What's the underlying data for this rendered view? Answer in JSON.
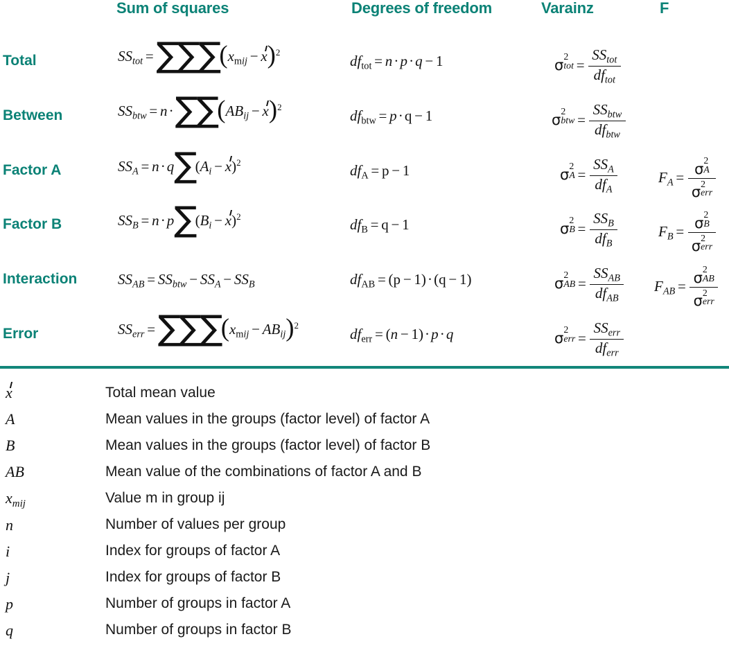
{
  "table": {
    "headers": [
      {
        "id": "sum-of-squares",
        "label": "Sum of squares"
      },
      {
        "id": "degrees-of-freedom",
        "label": "Degrees of freedom"
      },
      {
        "id": "varainz",
        "label": "Varainz"
      },
      {
        "id": "f",
        "label": "F"
      }
    ],
    "rows": [
      {
        "id": "total",
        "label": "Total",
        "ss": "SS_tot = ΣΣΣ(x_mij − x̄)²",
        "df": "df_tot = n · p · q − 1",
        "var": "σ²_tot = SS_tot / df_tot",
        "f": ""
      },
      {
        "id": "between",
        "label": "Between",
        "ss": "SS_btw = n · ΣΣ(AB_ij − x̄)²",
        "df": "df_btw = p · q − 1",
        "var": "σ²_btw = SS_btw / df_btw",
        "f": ""
      },
      {
        "id": "factor-a",
        "label": "Factor A",
        "ss": "SS_A = n · q Σ(A_i − x̄)²",
        "df": "df_A = p − 1",
        "var": "σ²_A = SS_A / df_A",
        "f": "F_A = σ²_A / σ²_err"
      },
      {
        "id": "factor-b",
        "label": "Factor B",
        "ss": "SS_B = n · p Σ(B_i − x̄)²",
        "df": "df_B = q − 1",
        "var": "σ²_B = SS_B / df_B",
        "f": "F_B = σ²_B / σ²_err"
      },
      {
        "id": "interaction",
        "label": "Interaction",
        "ss": "SS_AB = SS_btw − SS_A − SS_B",
        "df": "df_AB = (p − 1) · (q − 1)",
        "var": "σ²_AB = SS_AB / df_AB",
        "f": "F_AB = σ²_AB / σ²_err"
      },
      {
        "id": "error",
        "label": "Error",
        "ss": "SS_err = ΣΣΣ(x_mij − AB_ij)²",
        "df": "df_err = (n − 1) · p · q",
        "var": "σ²_err = SS_err / df_err",
        "f": ""
      }
    ]
  },
  "legend": [
    {
      "id": "x-bar",
      "symbol": "x̄",
      "description": "Total mean value"
    },
    {
      "id": "a",
      "symbol": "A",
      "description": "Mean values in the groups (factor level) of factor A"
    },
    {
      "id": "b",
      "symbol": "B",
      "description": "Mean values in the groups (factor level) of factor B"
    },
    {
      "id": "ab",
      "symbol": "AB",
      "description": "Mean value of the combinations of factor A and B"
    },
    {
      "id": "x-mij",
      "symbol": "x_mij",
      "description": "Value m in group ij"
    },
    {
      "id": "n",
      "symbol": "n",
      "description": "Number of values per group"
    },
    {
      "id": "i",
      "symbol": "i",
      "description": "Index for groups of factor A"
    },
    {
      "id": "j",
      "symbol": "j",
      "description": "Index for groups of factor B"
    },
    {
      "id": "p",
      "symbol": "p",
      "description": "Number of groups in factor A"
    },
    {
      "id": "q",
      "symbol": "q",
      "description": "Number of groups in factor B"
    }
  ],
  "colors": {
    "accent": "#0b8276",
    "divider": "#12867a",
    "text": "#111111",
    "background": "#ffffff"
  }
}
